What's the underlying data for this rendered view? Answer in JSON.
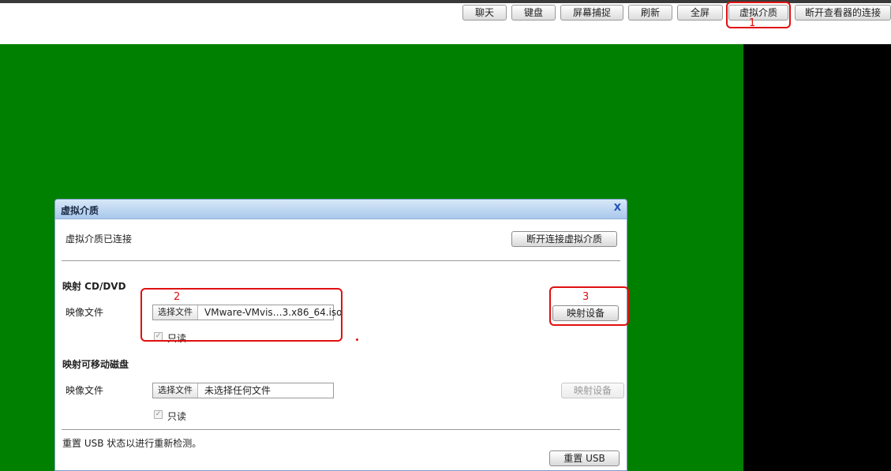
{
  "toolbar": {
    "chat": "聊天",
    "keyboard": "键盘",
    "screenshot": "屏幕捕捉",
    "refresh": "刷新",
    "fullscreen": "全屏",
    "virtual_media": "虚拟介质",
    "disconnect_viewer": "断开查看器的连接"
  },
  "annotations": {
    "n1": "1",
    "n2": "2",
    "n3": "3"
  },
  "colors": {
    "console": "#008000",
    "annotation": "#e01010",
    "title_bar": "#a9c8ec"
  },
  "dialog": {
    "title": "虚拟介质",
    "close": "X",
    "status": "虚拟介质已连接",
    "disconnect_button": "断开连接虚拟介质",
    "cd_section": {
      "heading": "映射 CD/DVD",
      "image_label": "映像文件",
      "choose_button": "选择文件",
      "file_name": "VMware-VMvis…3.x86_64.iso",
      "readonly_label": "只读",
      "map_button": "映射设备"
    },
    "removable_section": {
      "heading": "映射可移动磁盘",
      "image_label": "映像文件",
      "choose_button": "选择文件",
      "file_name": "未选择任何文件",
      "readonly_label": "只读",
      "map_button": "映射设备"
    },
    "usb_note": "重置 USB 状态以进行重新检测。",
    "reset_usb_button": "重置 USB"
  }
}
